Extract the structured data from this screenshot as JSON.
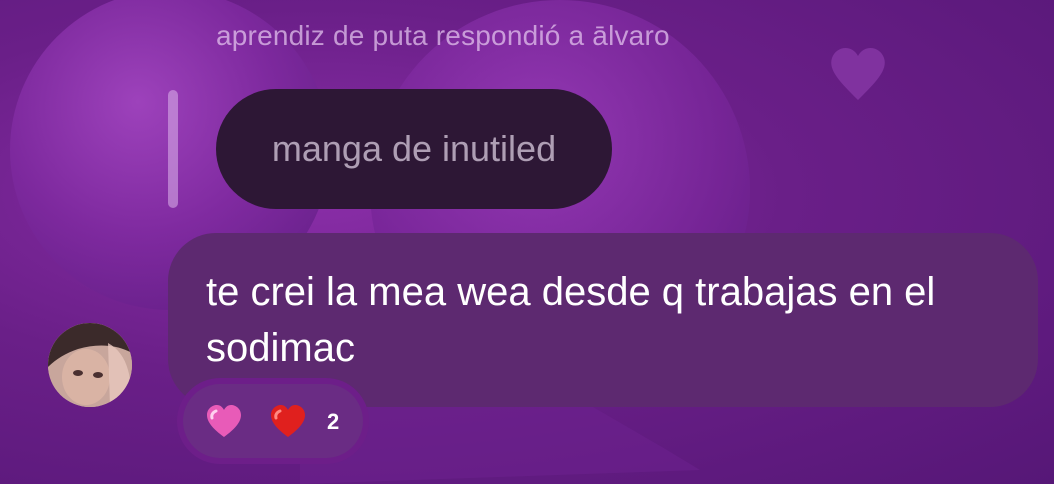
{
  "reply_header": "aprendiz de puta respondió a ālvaro",
  "quoted_message": {
    "text": "manga de inutiled"
  },
  "message": {
    "text": "te crei la mea wea desde q trabajas en el sodimac"
  },
  "reactions": {
    "items": [
      {
        "icon": "pink-heart-icon",
        "color": "#e85bb8"
      },
      {
        "icon": "red-heart-icon",
        "color": "#e0201e"
      }
    ],
    "count": "2"
  },
  "theme": {
    "background": "#6a1d86",
    "quoted_bubble": "#2d1735",
    "message_bubble": "#5d2970"
  }
}
